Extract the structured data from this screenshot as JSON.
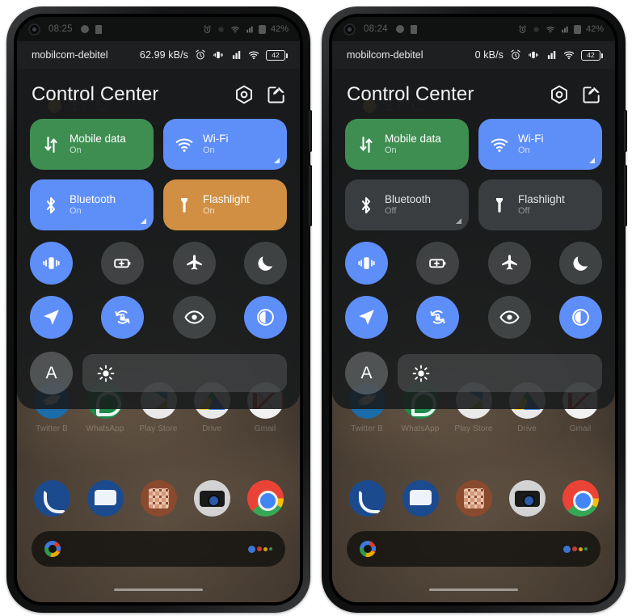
{
  "page": {
    "background": "#ffffff"
  },
  "colors": {
    "tile_green": "#3e8e52",
    "tile_blue": "#5e8ef7",
    "tile_orange": "#d08f42",
    "tile_gray": "#3a3d3f",
    "panel_bg": "#1a1c1d",
    "accent": "#5e8ef7"
  },
  "phones": [
    {
      "id": "left",
      "system_status": {
        "clock": "08:25",
        "battery_percent": "42%",
        "left_icons": [
          "camera-punch-hole",
          "record-dot-icon",
          "sim-icon"
        ],
        "right_icons": [
          "alarm-icon",
          "vibrate-icon",
          "wifi-icon",
          "signal-icon",
          "battery-icon"
        ]
      },
      "shade_status": {
        "carrier": "mobilcom-debitel",
        "net_speed": "62.99 kB/s",
        "icons": [
          "alarm-clock-icon",
          "vibrate-icon",
          "signal-bars-icon",
          "wifi-icon"
        ],
        "battery_badge": "42"
      },
      "header": {
        "title": "Control Center",
        "buttons": [
          {
            "name": "settings-hex-button",
            "icon": "hexagon-gear-icon"
          },
          {
            "name": "edit-button",
            "icon": "edit-pencil-icon"
          }
        ]
      },
      "tiles": [
        {
          "label": "Mobile data",
          "state": "On",
          "icon": "mobile-data-icon",
          "style": "green",
          "expandable": false
        },
        {
          "label": "Wi-Fi",
          "state": "On",
          "icon": "wifi-icon",
          "style": "blue",
          "expandable": true
        },
        {
          "label": "Bluetooth",
          "state": "On",
          "icon": "bluetooth-icon",
          "style": "blue",
          "expandable": true
        },
        {
          "label": "Flashlight",
          "state": "On",
          "icon": "flashlight-icon",
          "style": "orange",
          "expandable": false
        }
      ],
      "circle_toggles": [
        {
          "name": "vibrate-toggle",
          "icon": "vibrate-icon",
          "state": "on"
        },
        {
          "name": "battery-saver-toggle",
          "icon": "battery-saver-icon",
          "state": "off"
        },
        {
          "name": "airplane-mode-toggle",
          "icon": "airplane-icon",
          "state": "off"
        },
        {
          "name": "do-not-disturb-toggle",
          "icon": "moon-icon",
          "state": "off"
        },
        {
          "name": "location-toggle",
          "icon": "location-arrow-icon",
          "state": "on"
        },
        {
          "name": "auto-rotate-toggle",
          "icon": "rotation-lock-icon",
          "state": "on"
        },
        {
          "name": "eye-comfort-toggle",
          "icon": "eye-icon",
          "state": "off"
        },
        {
          "name": "dark-mode-toggle",
          "icon": "contrast-icon",
          "state": "on"
        }
      ],
      "brightness": {
        "auto_label": "A",
        "auto_name": "auto-brightness-button",
        "slider_icon": "brightness-sun-icon",
        "slider_fill_percent": 0
      },
      "home_screen": {
        "weather_widget": {
          "temperature": "17°C",
          "icon": "sun-icon"
        },
        "app_rows": [
          [
            {
              "label": "Twitter B",
              "icon": "twitter-icon"
            },
            {
              "label": "WhatsApp",
              "icon": "whatsapp-icon"
            },
            {
              "label": "Play Store",
              "icon": "play-store-icon"
            },
            {
              "label": "Drive",
              "icon": "google-drive-icon"
            },
            {
              "label": "Gmail",
              "icon": "gmail-icon"
            }
          ],
          [
            {
              "label": "",
              "icon": "phone-icon"
            },
            {
              "label": "",
              "icon": "messages-icon"
            },
            {
              "label": "",
              "icon": "calculator-icon"
            },
            {
              "label": "",
              "icon": "camera-icon"
            },
            {
              "label": "",
              "icon": "chrome-icon"
            }
          ]
        ],
        "search_bar": {
          "left_icon": "google-g-icon",
          "right_icon": "google-assistant-icon"
        }
      }
    },
    {
      "id": "right",
      "system_status": {
        "clock": "08:24",
        "battery_percent": "42%",
        "left_icons": [
          "camera-punch-hole",
          "record-dot-icon",
          "sim-icon"
        ],
        "right_icons": [
          "alarm-icon",
          "vibrate-icon",
          "wifi-icon",
          "signal-icon",
          "battery-icon"
        ]
      },
      "shade_status": {
        "carrier": "mobilcom-debitel",
        "net_speed": "0 kB/s",
        "icons": [
          "alarm-clock-icon",
          "vibrate-icon",
          "signal-bars-icon",
          "wifi-icon"
        ],
        "battery_badge": "42"
      },
      "header": {
        "title": "Control Center",
        "buttons": [
          {
            "name": "settings-hex-button",
            "icon": "hexagon-gear-icon"
          },
          {
            "name": "edit-button",
            "icon": "edit-pencil-icon"
          }
        ]
      },
      "tiles": [
        {
          "label": "Mobile data",
          "state": "On",
          "icon": "mobile-data-icon",
          "style": "green",
          "expandable": false
        },
        {
          "label": "Wi-Fi",
          "state": "On",
          "icon": "wifi-icon",
          "style": "blue",
          "expandable": true
        },
        {
          "label": "Bluetooth",
          "state": "Off",
          "icon": "bluetooth-icon",
          "style": "gray",
          "expandable": true
        },
        {
          "label": "Flashlight",
          "state": "Off",
          "icon": "flashlight-icon",
          "style": "gray",
          "expandable": false
        }
      ],
      "circle_toggles": [
        {
          "name": "vibrate-toggle",
          "icon": "vibrate-icon",
          "state": "on"
        },
        {
          "name": "battery-saver-toggle",
          "icon": "battery-saver-icon",
          "state": "off"
        },
        {
          "name": "airplane-mode-toggle",
          "icon": "airplane-icon",
          "state": "off"
        },
        {
          "name": "do-not-disturb-toggle",
          "icon": "moon-icon",
          "state": "off"
        },
        {
          "name": "location-toggle",
          "icon": "location-arrow-icon",
          "state": "on"
        },
        {
          "name": "auto-rotate-toggle",
          "icon": "rotation-lock-icon",
          "state": "on"
        },
        {
          "name": "eye-comfort-toggle",
          "icon": "eye-icon",
          "state": "off"
        },
        {
          "name": "dark-mode-toggle",
          "icon": "contrast-icon",
          "state": "on"
        }
      ],
      "brightness": {
        "auto_label": "A",
        "auto_name": "auto-brightness-button",
        "slider_icon": "brightness-sun-icon",
        "slider_fill_percent": 0
      },
      "home_screen": {
        "weather_widget": {
          "temperature": "17°C",
          "icon": "sun-icon"
        },
        "app_rows": [
          [
            {
              "label": "Twitter B",
              "icon": "twitter-icon"
            },
            {
              "label": "WhatsApp",
              "icon": "whatsapp-icon"
            },
            {
              "label": "Play Store",
              "icon": "play-store-icon"
            },
            {
              "label": "Drive",
              "icon": "google-drive-icon"
            },
            {
              "label": "Gmail",
              "icon": "gmail-icon"
            }
          ],
          [
            {
              "label": "",
              "icon": "phone-icon"
            },
            {
              "label": "",
              "icon": "messages-icon"
            },
            {
              "label": "",
              "icon": "calculator-icon"
            },
            {
              "label": "",
              "icon": "camera-icon"
            },
            {
              "label": "",
              "icon": "chrome-icon"
            }
          ]
        ],
        "search_bar": {
          "left_icon": "google-g-icon",
          "right_icon": "google-assistant-icon"
        }
      }
    }
  ]
}
